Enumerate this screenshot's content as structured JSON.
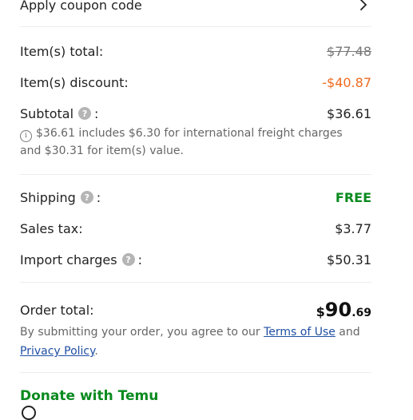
{
  "coupon": {
    "label": "Apply coupon code",
    "icon": "chevron-right-icon"
  },
  "summary": {
    "items_total_label": "Item(s) total:",
    "items_total_value": "$77.48",
    "discount_label": "Item(s) discount:",
    "discount_value": "-$40.87",
    "subtotal_label": "Subtotal",
    "subtotal_value": "$36.61",
    "subtotal_note": "$36.61 includes $6.30 for international freight charges and $30.31 for item(s) value.",
    "help_symbol": "?",
    "colon": ":"
  },
  "charges": {
    "shipping_label": "Shipping",
    "shipping_value": "FREE",
    "sales_tax_label": "Sales tax:",
    "sales_tax_value": "$3.77",
    "import_label": "Import charges",
    "import_value": "$50.31"
  },
  "order_total": {
    "label": "Order total:",
    "currency": "$",
    "whole": "90",
    "cents": ".69"
  },
  "agreement": {
    "prefix": "By submitting your order, you agree to our ",
    "terms_link": "Terms of Use",
    "middle": " and",
    "privacy_link": "Privacy Policy",
    "suffix": "."
  },
  "donate": {
    "label": "Donate with Temu"
  },
  "colors": {
    "discount": "#ef6a1f",
    "free": "#0a8a1f",
    "link": "#1f4fa3",
    "help_icon": "#b5b5b5"
  }
}
